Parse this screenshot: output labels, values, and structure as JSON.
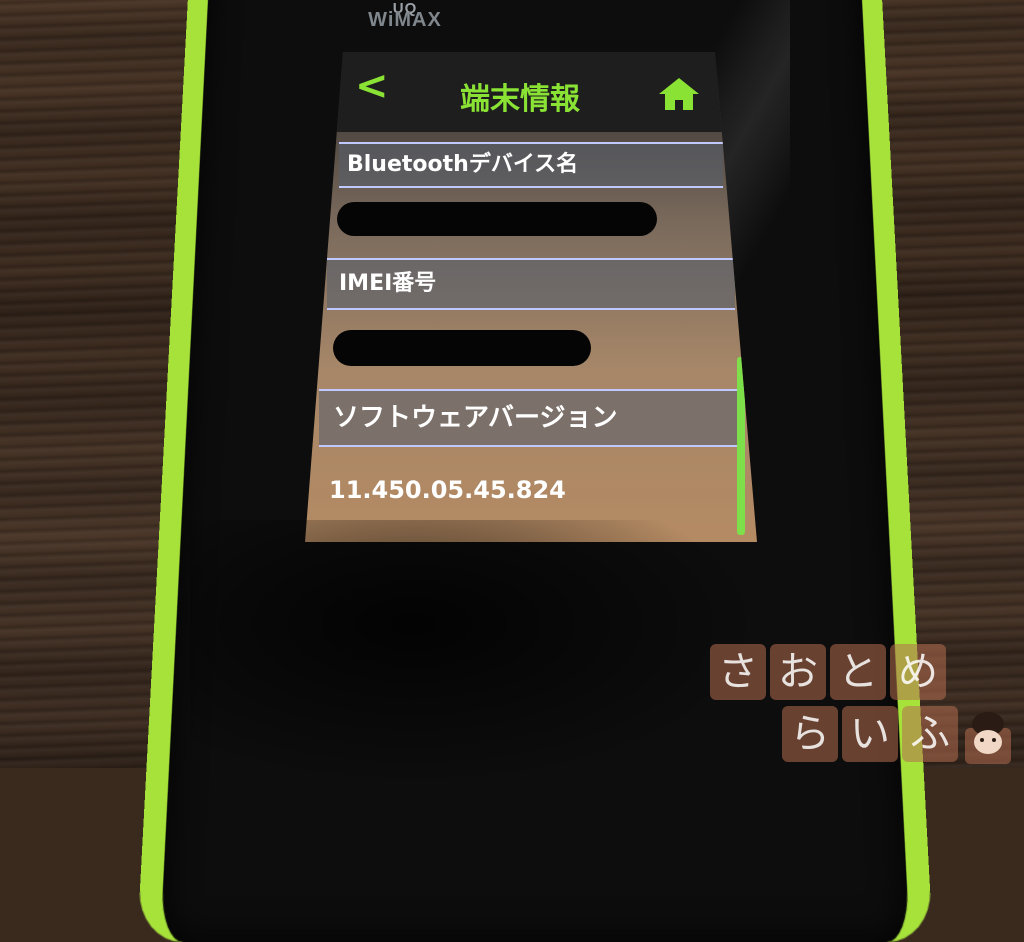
{
  "brand": {
    "top": "UQ",
    "bottom": "WiMAX"
  },
  "header": {
    "back_icon": "<",
    "title": "端末情報"
  },
  "rows": [
    {
      "label": "Bluetoothデバイス名",
      "value": ""
    },
    {
      "label": "IMEI番号",
      "value": ""
    },
    {
      "label": "ソフトウェアバージョン",
      "value": "11.450.05.45.824"
    }
  ],
  "watermark": {
    "line1": [
      "さ",
      "お",
      "と",
      "め"
    ],
    "line2": [
      "ら",
      "い",
      "ふ"
    ]
  },
  "colors": {
    "accent": "#8ae234",
    "device_frame": "#a6e23a",
    "divider": "#bfc9ff"
  }
}
